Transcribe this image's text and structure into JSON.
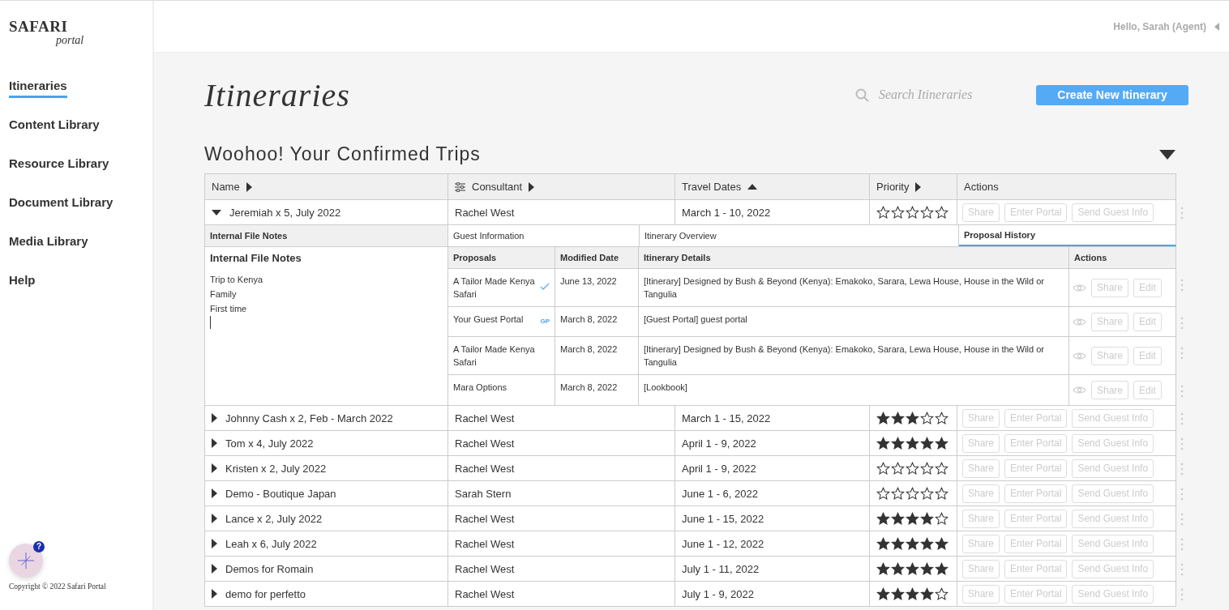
{
  "brand": {
    "name": "SAFARI",
    "sub": "portal"
  },
  "nav": [
    {
      "label": "Itineraries",
      "selected": true
    },
    {
      "label": "Content Library",
      "selected": false
    },
    {
      "label": "Resource Library",
      "selected": false
    },
    {
      "label": "Document Library",
      "selected": false
    },
    {
      "label": "Media Library",
      "selected": false
    },
    {
      "label": "Help",
      "selected": false
    }
  ],
  "help": {
    "badge": "?"
  },
  "copyright": "Copyright © 2022 Safari Portal",
  "user": {
    "greeting": "Hello, Sarah (Agent)"
  },
  "page": {
    "title": "Itineraries",
    "search_placeholder": "Search Itineraries",
    "create_button": "Create New Itinerary"
  },
  "section": {
    "title": "Woohoo! Your Confirmed Trips",
    "expanded": true
  },
  "table": {
    "columns": [
      {
        "label": "Name",
        "sortable": true,
        "sorted": false,
        "filter": false
      },
      {
        "label": "Consultant",
        "sortable": true,
        "sorted": false,
        "filter": true
      },
      {
        "label": "Travel Dates",
        "sortable": true,
        "sorted": true,
        "filter": false
      },
      {
        "label": "Priority",
        "sortable": true,
        "sorted": false,
        "filter": false
      },
      {
        "label": "Actions",
        "filter": false
      }
    ],
    "rows": [
      {
        "name": "Jeremiah x 5, July 2022",
        "consultant": "Rachel West",
        "dates": "March 1 - 10, 2022",
        "stars": 0,
        "expanded": true,
        "actions": [
          {
            "label": "Share",
            "disabled": true
          },
          {
            "label": "Enter Portal",
            "disabled": true
          },
          {
            "label": "Send Guest Info",
            "disabled": true
          }
        ],
        "detail": {
          "notes_tab": "Internal File Notes",
          "notes_title": "Internal File Notes",
          "notes": [
            "Trip to Kenya",
            "Family",
            "First time"
          ],
          "tabs": [
            {
              "label": "Guest Information",
              "selected": false
            },
            {
              "label": "Itinerary Overview",
              "selected": false
            },
            {
              "label": "Proposal History",
              "selected": true
            }
          ],
          "proposal_columns": [
            "Proposals",
            "Modified Date",
            "Itinerary Details",
            "Actions"
          ],
          "proposals": [
            {
              "name": "A Tailor Made Kenya Safari",
              "confirmed": true,
              "date": "June 13, 2022",
              "details": "[Itinerary] Designed by Bush & Beyond (Kenya): Emakoko, Sarara, Lewa House, House in the Wild or Tangulia",
              "actions": [
                {
                  "label": "Share",
                  "disabled": true
                },
                {
                  "label": "Edit",
                  "disabled": true
                }
              ]
            },
            {
              "name": "Your Guest Portal",
              "badge": "GP",
              "confirmed": false,
              "date": "March 8, 2022",
              "details": "[Guest Portal] guest portal",
              "actions": [
                {
                  "label": "Share",
                  "disabled": true
                },
                {
                  "label": "Edit",
                  "disabled": true
                }
              ]
            },
            {
              "name": "A Tailor Made Kenya Safari",
              "confirmed": false,
              "date": "March 8, 2022",
              "details": "[Itinerary] Designed by Bush & Beyond (Kenya): Emakoko, Sarara, Lewa House, House in the Wild or Tangulia",
              "actions": [
                {
                  "label": "Share",
                  "disabled": true
                },
                {
                  "label": "Edit",
                  "disabled": true
                }
              ]
            },
            {
              "name": "Mara Options",
              "confirmed": false,
              "date": "March 8, 2022",
              "details": "[Lookbook]",
              "actions": [
                {
                  "label": "Share",
                  "disabled": true
                },
                {
                  "label": "Edit",
                  "disabled": true
                }
              ]
            }
          ]
        }
      },
      {
        "name": "Johnny Cash x 2, Feb - March 2022",
        "consultant": "Rachel West",
        "dates": "March 1 - 15, 2022",
        "stars": 3,
        "expanded": false,
        "actions": [
          {
            "label": "Share",
            "disabled": true
          },
          {
            "label": "Enter Portal",
            "disabled": true
          },
          {
            "label": "Send Guest Info",
            "disabled": true
          }
        ]
      },
      {
        "name": "Tom x 4, July 2022",
        "consultant": "Rachel West",
        "dates": "April 1 - 9, 2022",
        "stars": 5,
        "expanded": false,
        "actions": [
          {
            "label": "Share",
            "disabled": true
          },
          {
            "label": "Enter Portal",
            "disabled": true
          },
          {
            "label": "Send Guest Info",
            "disabled": true
          }
        ]
      },
      {
        "name": "Kristen x 2, July 2022",
        "consultant": "Rachel West",
        "dates": "April 1 - 9, 2022",
        "stars": 0,
        "expanded": false,
        "actions": [
          {
            "label": "Share",
            "disabled": true
          },
          {
            "label": "Enter Portal",
            "disabled": true
          },
          {
            "label": "Send Guest Info",
            "disabled": true
          }
        ]
      },
      {
        "name": "Demo - Boutique Japan",
        "consultant": "Sarah Stern",
        "dates": "June 1 - 6, 2022",
        "stars": 0,
        "expanded": false,
        "actions": [
          {
            "label": "Share",
            "disabled": true
          },
          {
            "label": "Enter Portal",
            "disabled": true
          },
          {
            "label": "Send Guest Info",
            "disabled": true
          }
        ]
      },
      {
        "name": "Lance x 2, July 2022",
        "consultant": "Rachel West",
        "dates": "June 1 - 15, 2022",
        "stars": 4,
        "expanded": false,
        "actions": [
          {
            "label": "Share",
            "disabled": true
          },
          {
            "label": "Enter Portal",
            "disabled": true
          },
          {
            "label": "Send Guest Info",
            "disabled": true
          }
        ]
      },
      {
        "name": "Leah x 6, July 2022",
        "consultant": "Rachel West",
        "dates": "June 1 - 12, 2022",
        "stars": 5,
        "expanded": false,
        "actions": [
          {
            "label": "Share",
            "disabled": true
          },
          {
            "label": "Enter Portal",
            "disabled": true
          },
          {
            "label": "Send Guest Info",
            "disabled": true
          }
        ]
      },
      {
        "name": "Demos for Romain",
        "consultant": "Rachel West",
        "dates": "July 1 - 11, 2022",
        "stars": 5,
        "expanded": false,
        "actions": [
          {
            "label": "Share",
            "disabled": true
          },
          {
            "label": "Enter Portal",
            "disabled": true
          },
          {
            "label": "Send Guest Info",
            "disabled": true
          }
        ]
      },
      {
        "name": "demo for perfetto",
        "consultant": "Rachel West",
        "dates": "July 1 - 9, 2022",
        "stars": 4,
        "expanded": false,
        "actions": [
          {
            "label": "Share",
            "disabled": true
          },
          {
            "label": "Enter Portal",
            "disabled": true
          },
          {
            "label": "Send Guest Info",
            "disabled": true
          }
        ]
      }
    ]
  }
}
